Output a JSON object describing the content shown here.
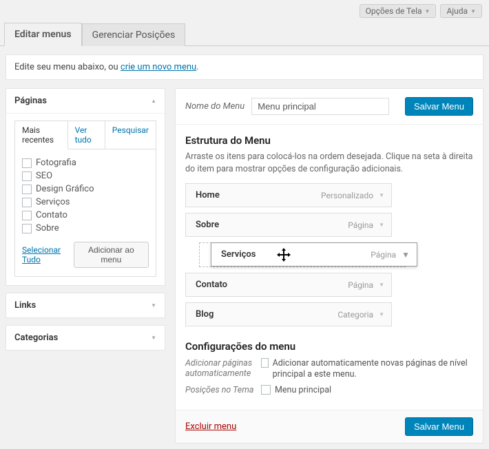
{
  "screen_options": "Opções de Tela",
  "help": "Ajuda",
  "tabs": {
    "edit": "Editar menus",
    "manage": "Gerenciar Posições"
  },
  "notice_prefix": "Edite seu menu abaixo, ou ",
  "notice_link": "crie um novo menu",
  "sidebar": {
    "pages": {
      "title": "Páginas",
      "inner_tabs": {
        "recent": "Mais recentes",
        "all": "Ver tudo",
        "search": "Pesquisar"
      },
      "items": [
        "Fotografia",
        "SEO",
        "Design Gráfico",
        "Serviços",
        "Contato",
        "Sobre"
      ],
      "select_all": "Selecionar Tudo",
      "add": "Adicionar ao menu"
    },
    "links": {
      "title": "Links"
    },
    "categories": {
      "title": "Categorias"
    }
  },
  "menu_name_label": "Nome do Menu",
  "menu_name_value": "Menu principal",
  "save": "Salvar Menu",
  "structure": {
    "title": "Estrutura do Menu",
    "desc": "Arraste os itens para colocá-los na ordem desejada. Clique na seta à direita do item para mostrar opções de configuração adicionais.",
    "items": [
      {
        "label": "Home",
        "type": "Personalizado"
      },
      {
        "label": "Sobre",
        "type": "Página"
      },
      {
        "label": "Serviços",
        "type": "Página",
        "dragging": true
      },
      {
        "label": "Contato",
        "type": "Página"
      },
      {
        "label": "Blog",
        "type": "Categoria"
      }
    ]
  },
  "settings": {
    "title": "Configurações do menu",
    "auto_add_label": "Adicionar páginas automaticamente",
    "auto_add_text": "Adicionar automaticamente novas páginas de nível principal a este menu.",
    "location_label": "Posições no Tema",
    "location_text": "Menu principal"
  },
  "delete": "Excluir menu"
}
